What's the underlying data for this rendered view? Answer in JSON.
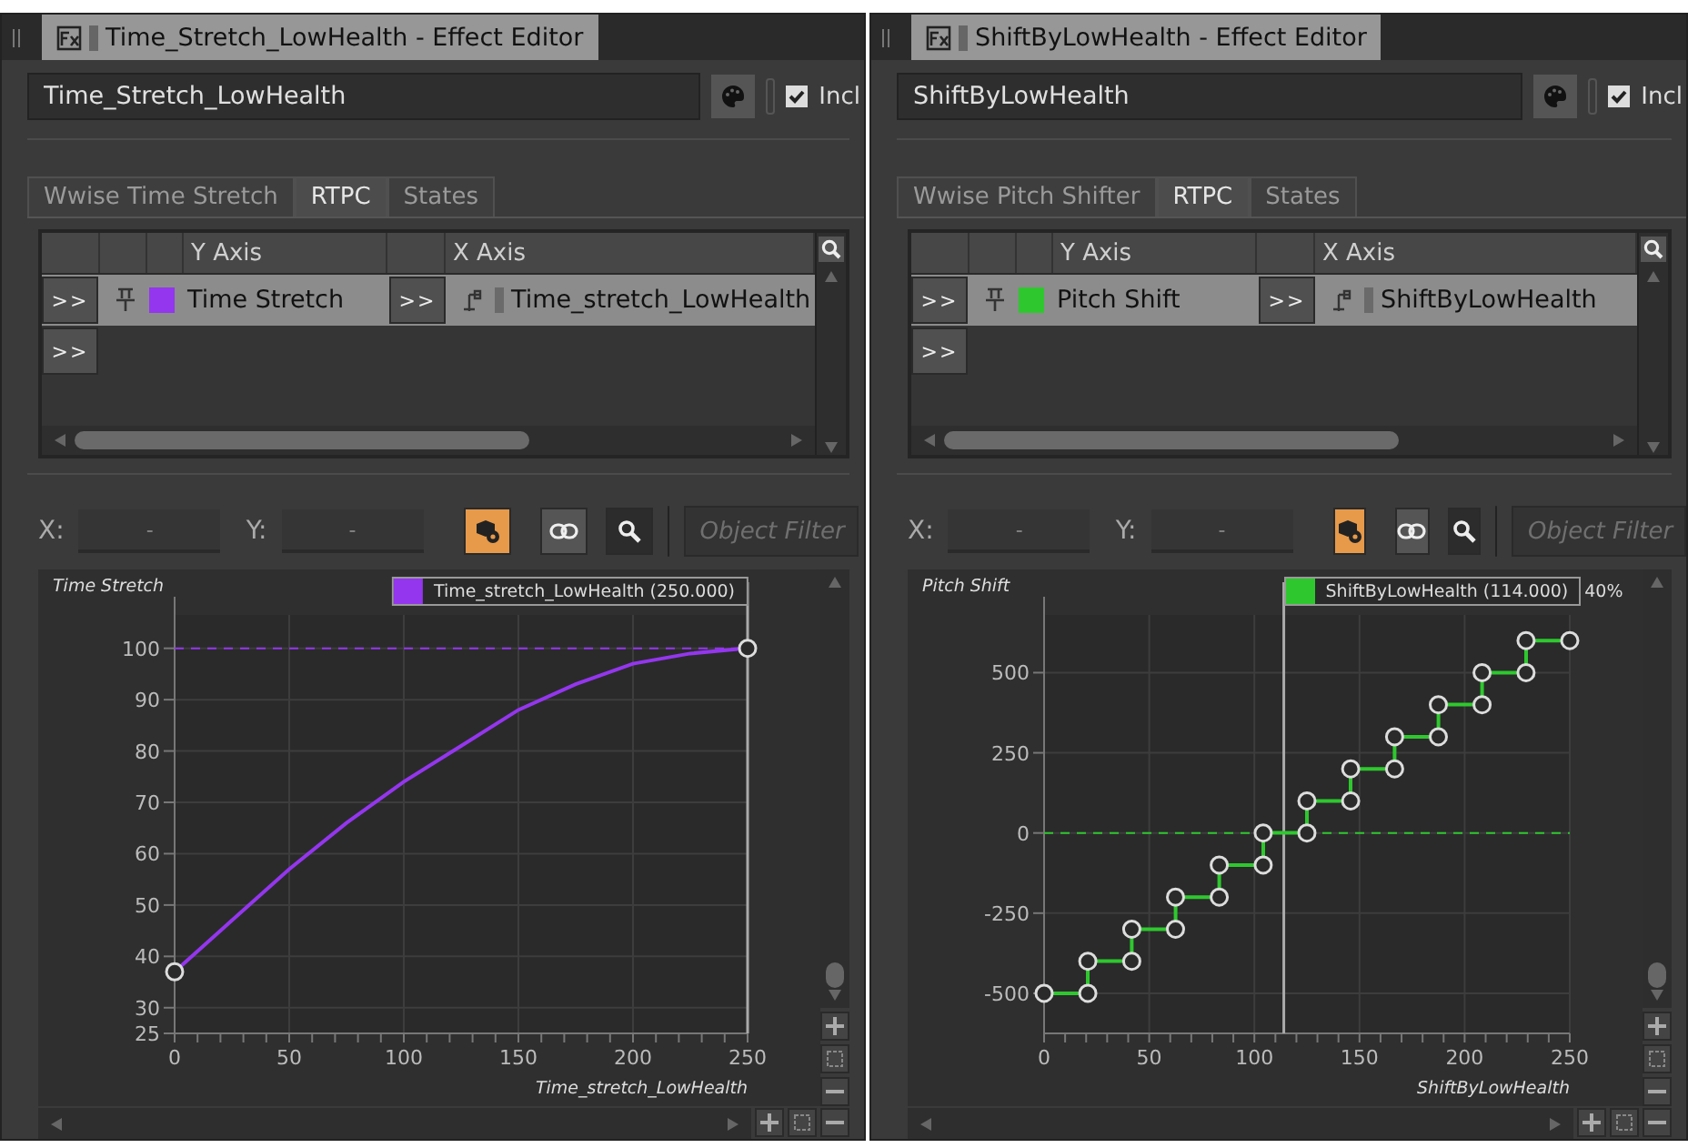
{
  "panels": [
    {
      "tab_title": "Time_Stretch_LowHealth - Effect Editor",
      "name": "Time_Stretch_LowHealth",
      "include_label": "Incl",
      "include_checked": true,
      "tabs": [
        {
          "label": "Wwise Time Stretch",
          "selected": false
        },
        {
          "label": "RTPC",
          "selected": true
        },
        {
          "label": "States",
          "selected": false
        }
      ],
      "table": {
        "columns": [
          "Y Axis",
          "X Axis"
        ],
        "rows": [
          {
            "expand": ">>",
            "y_axis": "Time Stretch",
            "color": "#9436ee",
            "x_button": ">>",
            "x_axis": "Time_stretch_LowHealth",
            "selected": true
          },
          {
            "expand": ">>",
            "selected": false
          }
        ]
      },
      "toolbar": {
        "x_label": "X:",
        "x_value": "-",
        "y_label": "Y:",
        "y_value": "-",
        "filter_placeholder": "Object Filter"
      },
      "chart_data": {
        "type": "line",
        "xlabel": "Time_stretch_LowHealth",
        "x": [
          0,
          25,
          50,
          75,
          100,
          125,
          150,
          175,
          200,
          225,
          250
        ],
        "series": [
          {
            "name": "Time Stretch",
            "color": "#9436ee",
            "values": [
              37,
              47,
              57,
              66,
              74,
              81,
              88,
              93,
              97,
              99,
              100
            ]
          }
        ],
        "xlim": [
          0,
          250
        ],
        "ylim": [
          25,
          106.5
        ],
        "xticks": [
          0,
          50,
          100,
          150,
          200,
          250
        ],
        "yticks": [
          25,
          30,
          40,
          50,
          60,
          70,
          80,
          90,
          100
        ],
        "grid": true,
        "ref_lines": [
          {
            "axis": "x",
            "value": 250
          },
          {
            "axis": "y",
            "value": 100
          }
        ],
        "annotations": [
          "Time_stretch_LowHealth (250.000)"
        ]
      }
    },
    {
      "tab_title": "ShiftByLowHealth - Effect Editor",
      "name": "ShiftByLowHealth",
      "include_label": "Incl",
      "include_checked": true,
      "tabs": [
        {
          "label": "Wwise Pitch Shifter",
          "selected": false
        },
        {
          "label": "RTPC",
          "selected": true
        },
        {
          "label": "States",
          "selected": false
        }
      ],
      "table": {
        "columns": [
          "Y Axis",
          "X Axis"
        ],
        "rows": [
          {
            "expand": ">>",
            "y_axis": "Pitch Shift",
            "color": "#2ec82e",
            "x_button": ">>",
            "x_axis": "ShiftByLowHealth",
            "selected": true
          },
          {
            "expand": ">>",
            "selected": false
          }
        ]
      },
      "toolbar": {
        "x_label": "X:",
        "x_value": "-",
        "y_label": "Y:",
        "y_value": "-",
        "filter_placeholder": "Object Filter"
      },
      "cursor_note": "40%",
      "chart_data": {
        "type": "line",
        "xlabel": "ShiftByLowHealth",
        "x": [
          0,
          20.8,
          20.8,
          41.7,
          41.7,
          62.5,
          62.5,
          83.3,
          83.3,
          104.2,
          104.2,
          125,
          125,
          145.8,
          145.8,
          166.7,
          166.7,
          187.5,
          187.5,
          208.3,
          208.3,
          229.2,
          229.2,
          250
        ],
        "series": [
          {
            "name": "Pitch Shift",
            "color": "#2ec82e",
            "values": [
              -500,
              -500,
              -400,
              -400,
              -300,
              -300,
              -200,
              -200,
              -100,
              -100,
              0,
              0,
              100,
              100,
              200,
              200,
              300,
              300,
              400,
              400,
              500,
              500,
              600,
              600
            ],
            "marker": "circle"
          }
        ],
        "xlim": [
          0,
          250
        ],
        "ylim": [
          -625,
          680
        ],
        "xticks": [
          0,
          50,
          100,
          150,
          200,
          250
        ],
        "yticks": [
          -500,
          -250,
          0,
          250,
          500
        ],
        "grid": true,
        "ref_lines": [
          {
            "axis": "x",
            "value": 114
          },
          {
            "axis": "y",
            "value": 0
          }
        ],
        "annotations": [
          "ShiftByLowHealth (114.000)"
        ]
      }
    }
  ]
}
